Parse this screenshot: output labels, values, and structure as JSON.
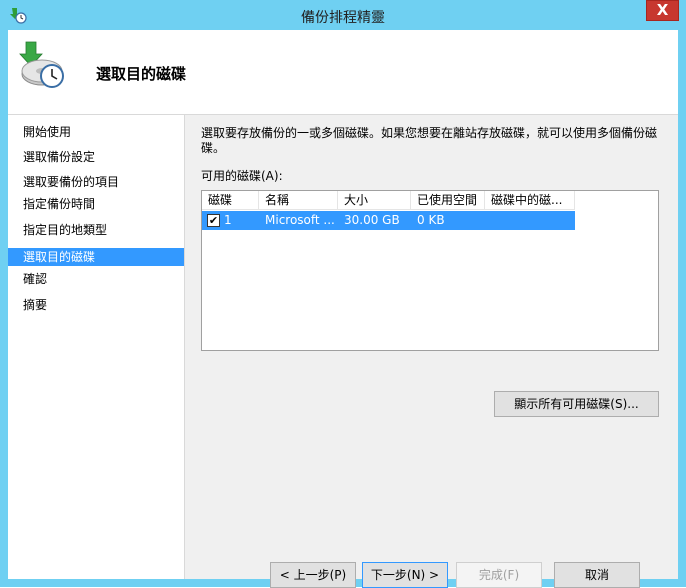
{
  "window": {
    "title": "備份排程精靈",
    "close_glyph": "X"
  },
  "header": {
    "title": "選取目的磁碟"
  },
  "sidebar": {
    "items": [
      {
        "label": "開始使用",
        "active": false
      },
      {
        "label": "選取備份設定",
        "active": false
      },
      {
        "label": "選取要備份的項目",
        "active": false
      },
      {
        "label": "指定備份時間",
        "active": false
      },
      {
        "label": "指定目的地類型",
        "active": false
      },
      {
        "label": "選取目的磁碟",
        "active": true
      },
      {
        "label": "確認",
        "active": false
      },
      {
        "label": "摘要",
        "active": false
      }
    ]
  },
  "main": {
    "description": "選取要存放備份的一或多個磁碟。如果您想要在離站存放磁碟，就可以使用多個備份磁碟。",
    "list_label": "可用的磁碟(A):",
    "columns": [
      "磁碟",
      "名稱",
      "大小",
      "已使用空間",
      "磁碟中的磁..."
    ],
    "rows": [
      {
        "checked": true,
        "check_glyph": "✔",
        "disk": "1",
        "name": "Microsoft ...",
        "size": "30.00 GB",
        "used": "0 KB",
        "backups": ""
      }
    ],
    "show_all_button": "顯示所有可用磁碟(S)..."
  },
  "footer": {
    "prev_button": "< 上一步(P)",
    "next_button": "下一步(N) >",
    "finish_button": "完成(F)",
    "cancel_button": "取消"
  },
  "colors": {
    "titlebar": "#6fd0f2",
    "selection": "#3399ff",
    "close": "#c7372f"
  },
  "icons": {
    "app": "backup-clock-icon",
    "header": "backup-disk-clock-icon"
  }
}
